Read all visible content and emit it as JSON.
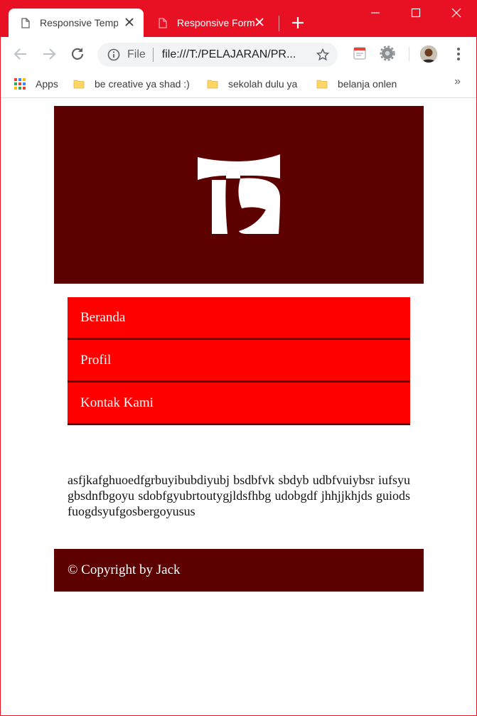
{
  "browser": {
    "tabs": [
      {
        "title": "Responsive Template",
        "active": true
      },
      {
        "title": "Responsive Form",
        "active": false
      }
    ],
    "omnibox": {
      "scheme": "File",
      "url": "file:///T:/PELAJARAN/PR..."
    },
    "bookmarks": [
      {
        "label": "Apps",
        "icon": "apps-grid-icon"
      },
      {
        "label": "be creative ya shad :)",
        "icon": "folder-icon"
      },
      {
        "label": "sekolah dulu ya",
        "icon": "folder-icon"
      },
      {
        "label": "belanja onlen",
        "icon": "folder-icon"
      }
    ],
    "bookmarks_overflow": "»",
    "colors": {
      "frame": "#e81123",
      "toolbar": "#ffffff"
    }
  },
  "page": {
    "nav": [
      {
        "label": "Beranda"
      },
      {
        "label": "Profil"
      },
      {
        "label": "Kontak Kami"
      }
    ],
    "content": "asfjkafghuoedfgrbuyibubdiyubj bsdbfvk sbdyb udbfvuiybsr iufsyu gbsdnfbgoyu sdobfgyubrtoutygjldsfhbg udobgdf jhhjjkhjds guiods fuogdsyufgosbergoyusus",
    "footer": "© Copyright by Jack",
    "colors": {
      "header": "#5c0000",
      "nav": "#ff0000",
      "footer": "#5c0000"
    }
  }
}
